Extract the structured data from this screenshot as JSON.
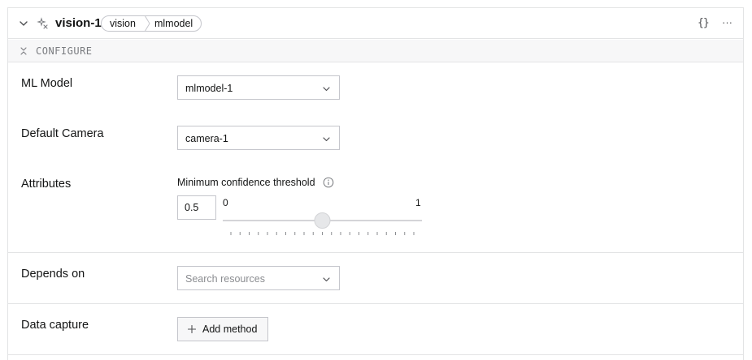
{
  "header": {
    "title": "vision-1",
    "breadcrumb": [
      "vision",
      "mlmodel"
    ],
    "json_icon": "{}",
    "more_icon": "···"
  },
  "section": {
    "title": "CONFIGURE"
  },
  "fields": {
    "ml_model": {
      "label": "ML Model",
      "value": "mlmodel-1"
    },
    "default_camera": {
      "label": "Default Camera",
      "value": "camera-1"
    },
    "attributes": {
      "label": "Attributes",
      "threshold_label": "Minimum confidence threshold",
      "threshold_value": "0.5",
      "range_min": "0",
      "range_max": "1",
      "slider_fraction": 0.5
    },
    "depends_on": {
      "label": "Depends on",
      "placeholder": "Search resources"
    },
    "data_capture": {
      "label": "Data capture",
      "button_label": "Add method"
    }
  },
  "icons": {
    "collapse": "chevron-down-icon",
    "service": "sparkle-icon",
    "section": "collapse-vertical-icon",
    "info": "info-icon",
    "plus": "plus-icon"
  }
}
